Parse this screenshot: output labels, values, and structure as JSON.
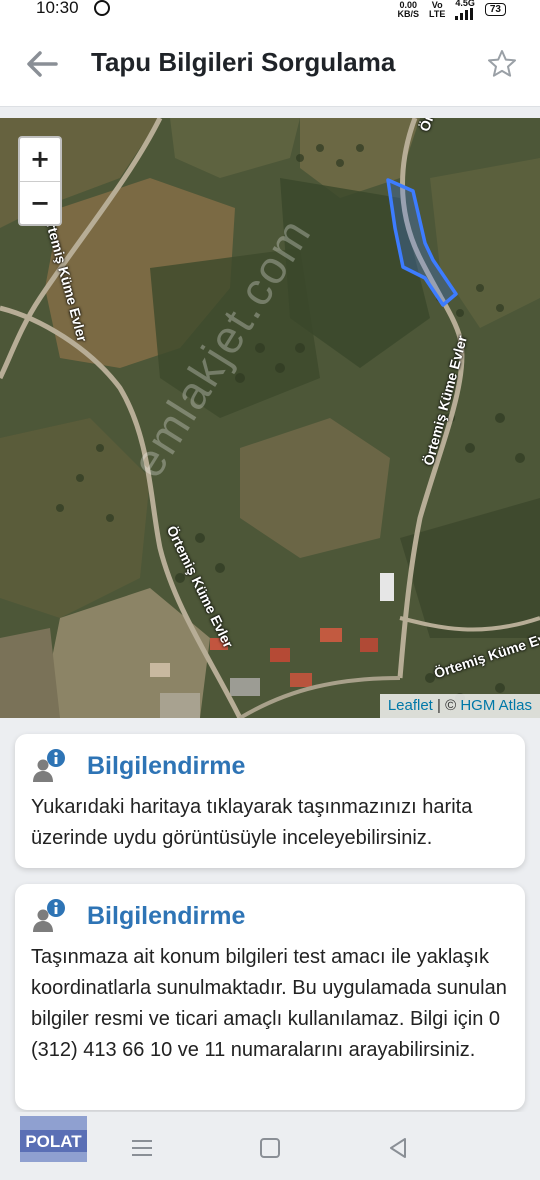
{
  "status_bar": {
    "time": "10:30",
    "speed_value": "0.00",
    "speed_unit": "KB/S",
    "vo_label": "Vo",
    "lte_label": "LTE",
    "net_type": "4.5G",
    "battery": "73"
  },
  "header": {
    "title": "Tapu Bilgileri Sorgulama"
  },
  "map": {
    "zoom_in": "+",
    "zoom_out": "−",
    "attribution_leaflet": "Leaflet",
    "attribution_sep": " | © ",
    "attribution_source": "HGM Atlas",
    "road_label_1": "Örtemiş Küme Evler",
    "road_label_2": "Örtemiş Küme Evler",
    "road_label_3": "Örtemiş Küme Evler",
    "road_label_4": "Örtemiş Küme Evle",
    "road_label_5": "Örte",
    "watermark": "emlakjet.com"
  },
  "cards": [
    {
      "title": "Bilgilendirme",
      "body": "Yukarıdaki haritaya tıklayarak taşınmazınızı harita üzerinde uydu görüntüsüyle inceleyebilirsiniz."
    },
    {
      "title": "Bilgilendirme",
      "body": "Taşınmaza ait konum bilgileri test amacı ile yaklaşık koordinatlarla sunulmaktadır. Bu uygulamada sunulan bilgiler resmi ve ticari amaçlı kullanılamaz. Bilgi için 0 (312) 413 66 10 ve 11 numaralarını arayabilirsiniz."
    }
  ],
  "footer": {
    "logo_text": "POLAT"
  },
  "colors": {
    "accent_blue": "#2e74b5",
    "parcel_outline": "#3d7cff",
    "link": "#0078a8"
  }
}
